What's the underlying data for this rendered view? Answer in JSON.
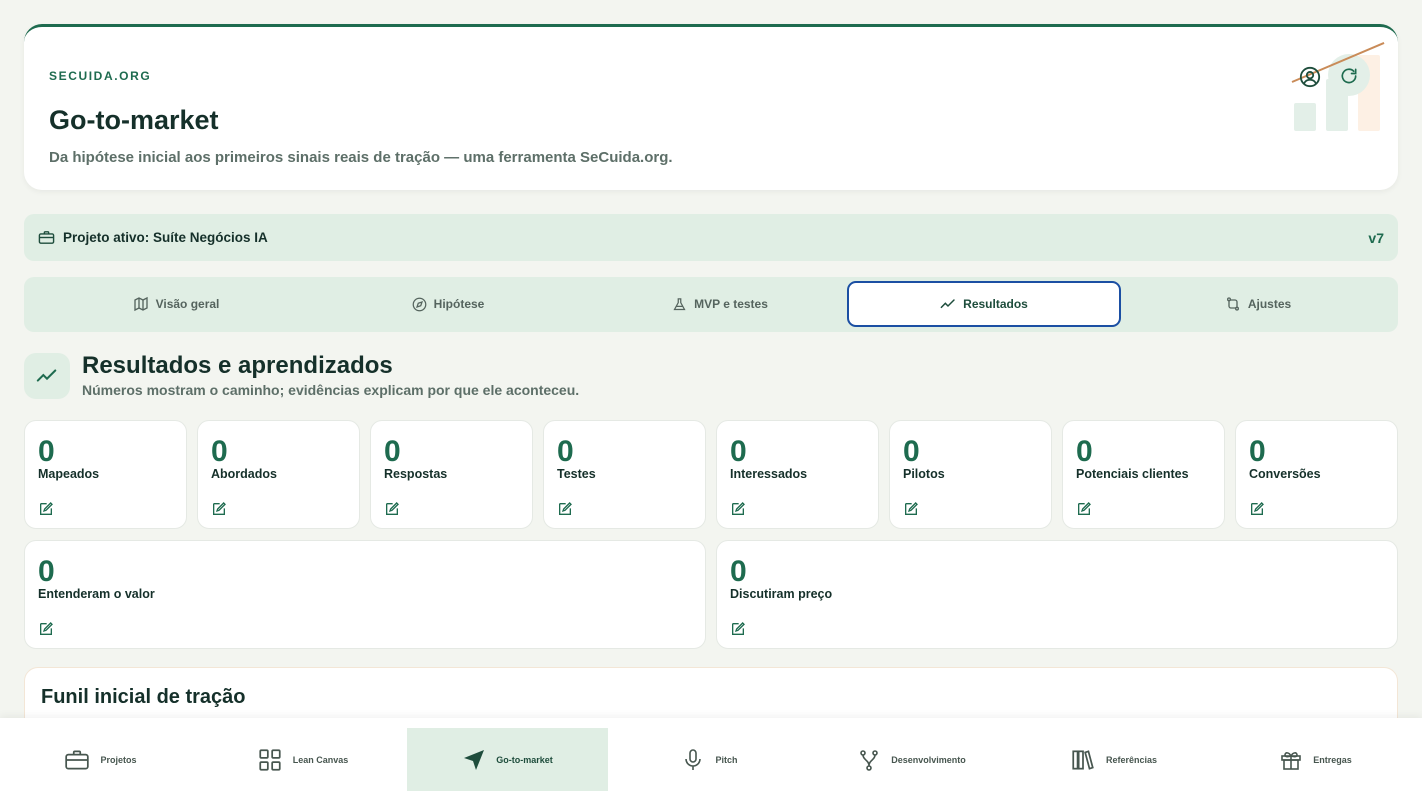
{
  "header": {
    "brand": "SECUIDA.ORG",
    "title": "Go-to-market",
    "subtitle": "Da hipótese inicial aos primeiros sinais reais de tração — uma ferramenta SeCuida.org."
  },
  "project": {
    "label": "Projeto ativo: Suíte Negócios IA",
    "version": "v7"
  },
  "tabs": [
    {
      "label": "Visão geral",
      "icon": "map-icon"
    },
    {
      "label": "Hipótese",
      "icon": "compass-icon"
    },
    {
      "label": "MVP e testes",
      "icon": "flask-icon"
    },
    {
      "label": "Resultados",
      "icon": "trending-icon",
      "active": true
    },
    {
      "label": "Ajustes",
      "icon": "adjust-icon"
    }
  ],
  "section": {
    "title": "Resultados e aprendizados",
    "subtitle": "Números mostram o caminho; evidências explicam por que ele aconteceu."
  },
  "metrics": [
    {
      "value": "0",
      "label": "Mapeados"
    },
    {
      "value": "0",
      "label": "Abordados"
    },
    {
      "value": "0",
      "label": "Respostas"
    },
    {
      "value": "0",
      "label": "Testes"
    },
    {
      "value": "0",
      "label": "Interessados"
    },
    {
      "value": "0",
      "label": "Pilotos"
    },
    {
      "value": "0",
      "label": "Potenciais clientes"
    },
    {
      "value": "0",
      "label": "Conversões"
    },
    {
      "value": "0",
      "label": "Entenderam o valor"
    },
    {
      "value": "0",
      "label": "Discutiram preço"
    }
  ],
  "funnel": {
    "title": "Funil inicial de tração"
  },
  "nav": [
    {
      "label": "Projetos",
      "icon": "briefcase-icon"
    },
    {
      "label": "Lean Canvas",
      "icon": "grid-icon"
    },
    {
      "label": "Go-to-market",
      "icon": "navigation-icon",
      "active": true
    },
    {
      "label": "Pitch",
      "icon": "microphone-icon"
    },
    {
      "label": "Desenvolvimento",
      "icon": "git-branch-icon"
    },
    {
      "label": "Referências",
      "icon": "library-icon"
    },
    {
      "label": "Entregas",
      "icon": "gift-icon"
    }
  ],
  "colors": {
    "accent": "#1e6b4f",
    "tint": "#e0eee4",
    "active_border": "#1b4fa3"
  }
}
